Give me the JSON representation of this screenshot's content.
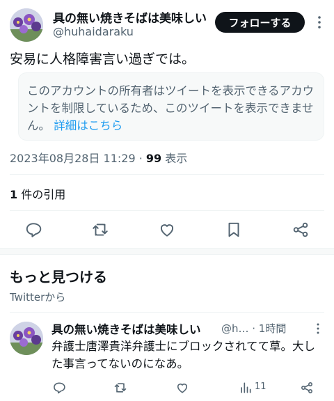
{
  "author": {
    "display_name": "具の無い焼きそばは美味しい",
    "handle": "@huhaidaraku"
  },
  "follow_label": "フォローする",
  "tweet": {
    "text": "安易に人格障害言い過ぎでは。",
    "quoted_notice": "このアカウントの所有者はツイートを表示できるアカウントを制限しているため、このツイートを表示できません。",
    "quoted_link": "詳細はこちら",
    "timestamp": "2023年08月28日 11:29",
    "separator": "·",
    "views_count": "99",
    "views_label": "表示"
  },
  "quotes": {
    "count": "1",
    "label": "件の引用"
  },
  "discover": {
    "title": "もっと見つける",
    "subtitle": "Twitterから"
  },
  "recommended": {
    "display_name": "具の無い焼きそばは美味しい",
    "handle_time": "@h… · 1時間",
    "text": "弁護士唐澤貴洋弁護士にブロックされてて草。大した事言ってないのになあ。",
    "views": "11"
  },
  "icons": {
    "reply": "reply-icon",
    "retweet": "retweet-icon",
    "like": "like-icon",
    "bookmark": "bookmark-icon",
    "share": "share-icon",
    "views": "views-icon",
    "more": "more-icon"
  },
  "colors": {
    "text": "#0f1419",
    "secondary": "#536471",
    "link": "#1d9bf0",
    "button_bg": "#0f1419"
  }
}
